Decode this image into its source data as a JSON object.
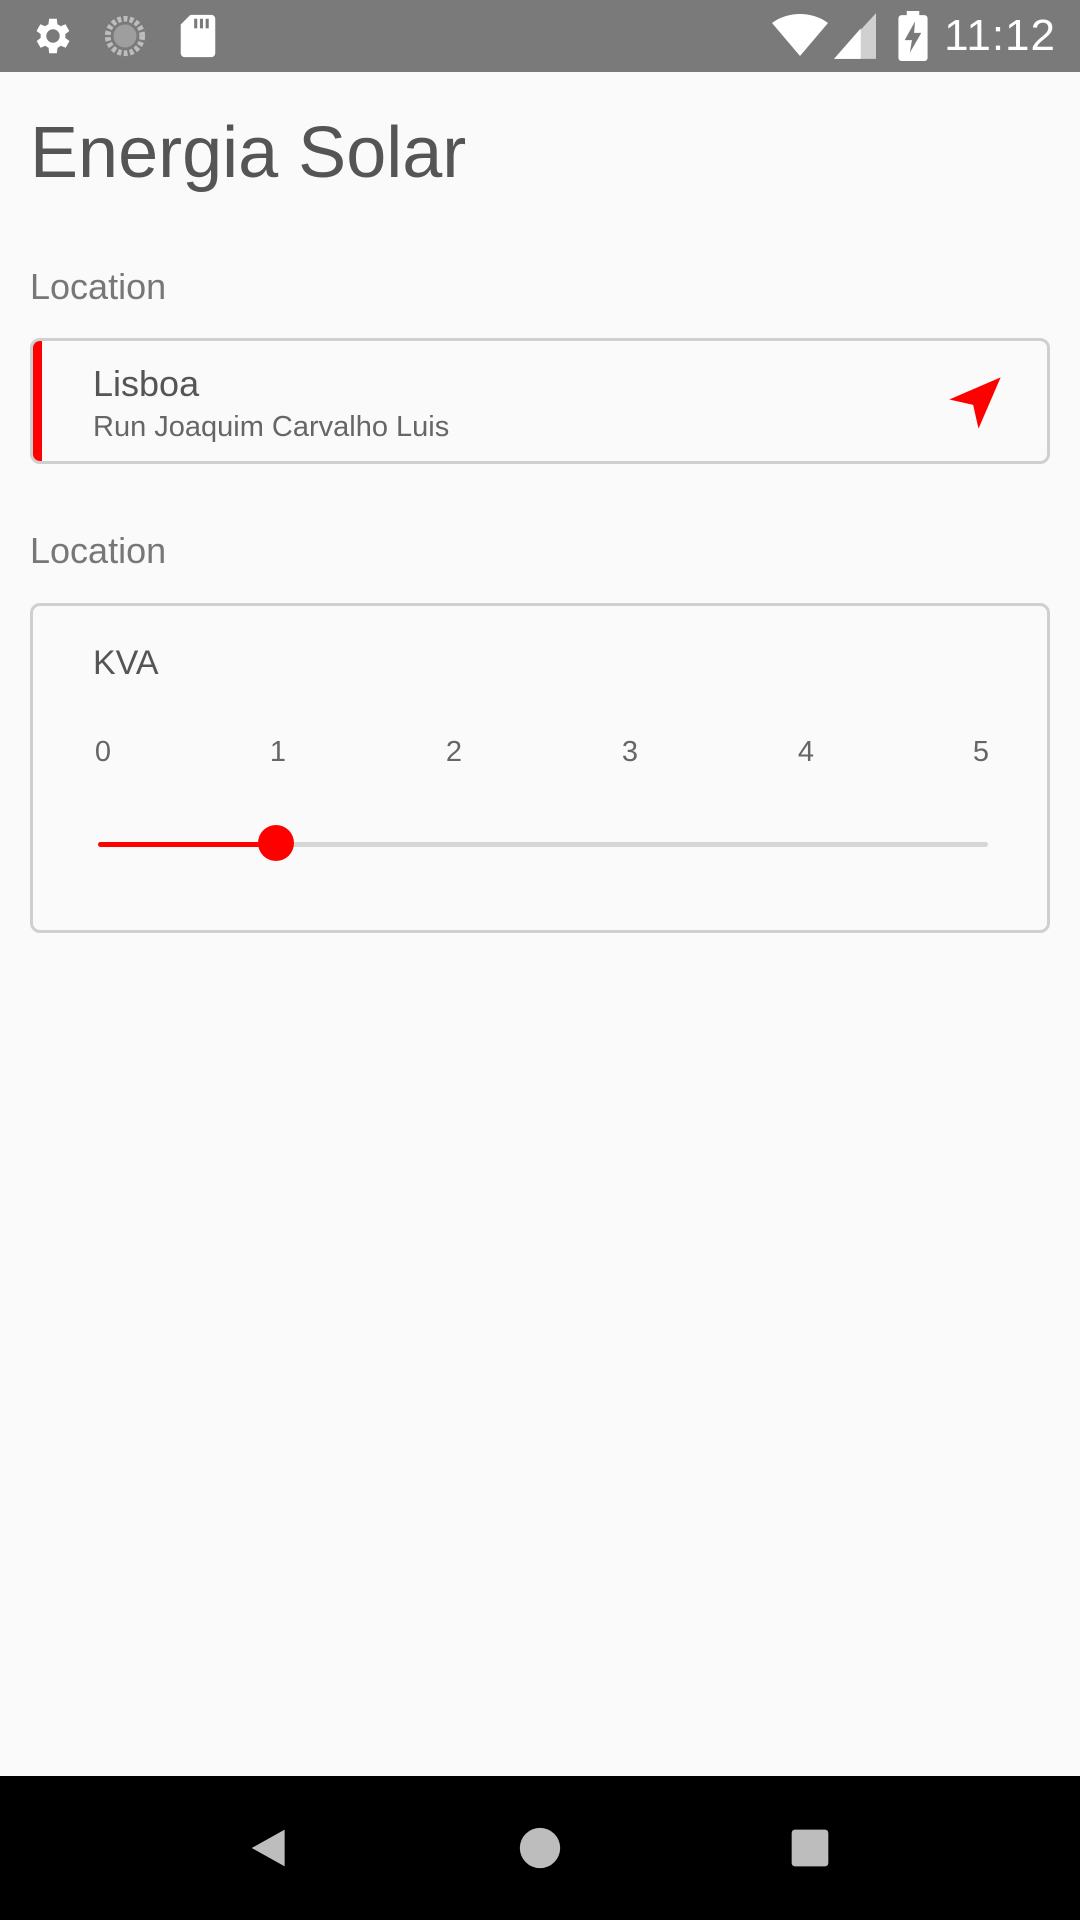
{
  "status_bar": {
    "time": "11:12",
    "icons": [
      "gear-icon",
      "loading-icon",
      "sd-card-icon",
      "wifi-icon",
      "cell-signal-icon",
      "battery-charging-icon"
    ]
  },
  "app": {
    "title": "Energia Solar"
  },
  "location_section": {
    "label": "Location",
    "city": "Lisboa",
    "street": "Run Joaquim Carvalho Luis",
    "icon": "navigation-arrow-icon",
    "accent_color": "#ff0000"
  },
  "kva_section": {
    "label": "Location",
    "title": "KVA",
    "ticks": [
      "0",
      "1",
      "2",
      "3",
      "4",
      "5"
    ],
    "slider_min": 0,
    "slider_max": 5,
    "slider_value": 1,
    "accent_color": "#ff0000"
  },
  "nav_bar": {
    "buttons": [
      "back-icon",
      "home-icon",
      "recents-icon"
    ]
  }
}
